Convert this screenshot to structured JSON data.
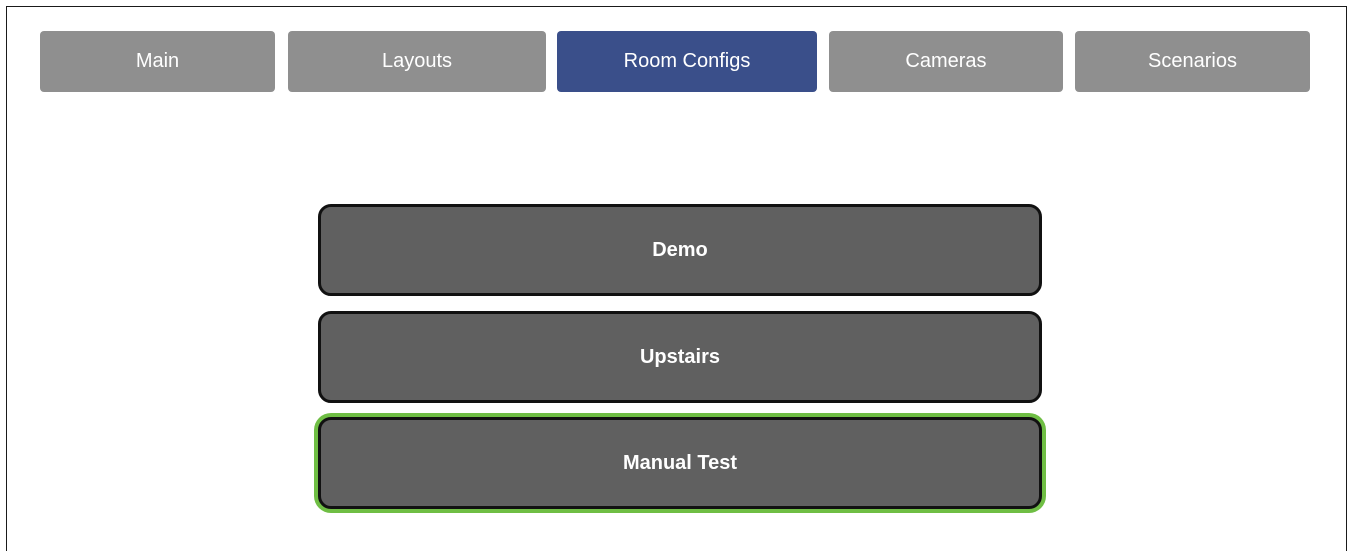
{
  "tabs": [
    {
      "label": "Main",
      "active": false
    },
    {
      "label": "Layouts",
      "active": false
    },
    {
      "label": "Room Configs",
      "active": true
    },
    {
      "label": "Cameras",
      "active": false
    },
    {
      "label": "Scenarios",
      "active": false
    }
  ],
  "rooms": [
    {
      "label": "Demo",
      "selected": false
    },
    {
      "label": "Upstairs",
      "selected": false
    },
    {
      "label": "Manual Test",
      "selected": true
    }
  ],
  "colors": {
    "tab_inactive": "#8f8f8f",
    "tab_active": "#3a4f8a",
    "room_button": "#606060",
    "selected_outline": "#6fbe44"
  }
}
